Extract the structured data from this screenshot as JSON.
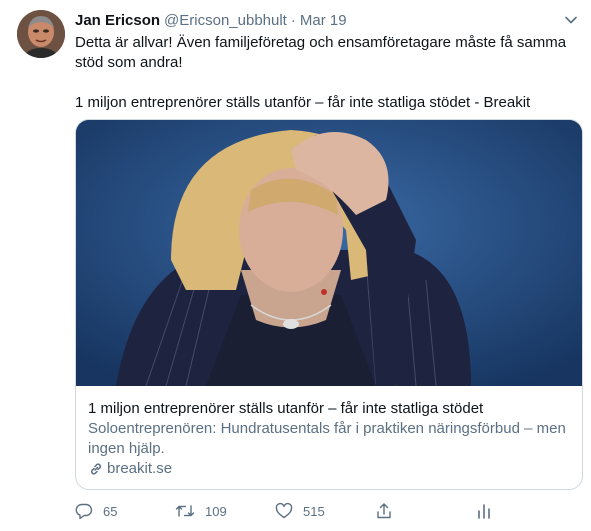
{
  "tweet": {
    "author_name": "Jan Ericson",
    "handle": "@Ericson_ubbhult",
    "separator": "·",
    "date": "Mar 19",
    "text_line1": "Detta är allvar! Även familjeföretag och ensamföretagare måste få samma stöd som andra!",
    "text_line2": "1 miljon entreprenörer ställs utanför – får inte statliga stödet - Breakit"
  },
  "card": {
    "title": "1 miljon entreprenörer ställs utanför – får inte statliga stödet",
    "description": "Soloentreprenören: Hundratusentals får i praktiken näringsförbud – men ingen hjälp.",
    "domain": "breakit.se"
  },
  "actions": {
    "reply_count": "65",
    "retweet_count": "109",
    "like_count": "515"
  },
  "icons": {
    "caret": "chevron-down-icon",
    "reply": "reply-icon",
    "retweet": "retweet-icon",
    "like": "heart-icon",
    "share": "share-icon",
    "analytics": "analytics-icon",
    "link": "link-icon"
  },
  "colors": {
    "text": "#0f1419",
    "secondary": "#5b7083",
    "border": "#cfd9de",
    "image_background": "#1f3e6f"
  }
}
